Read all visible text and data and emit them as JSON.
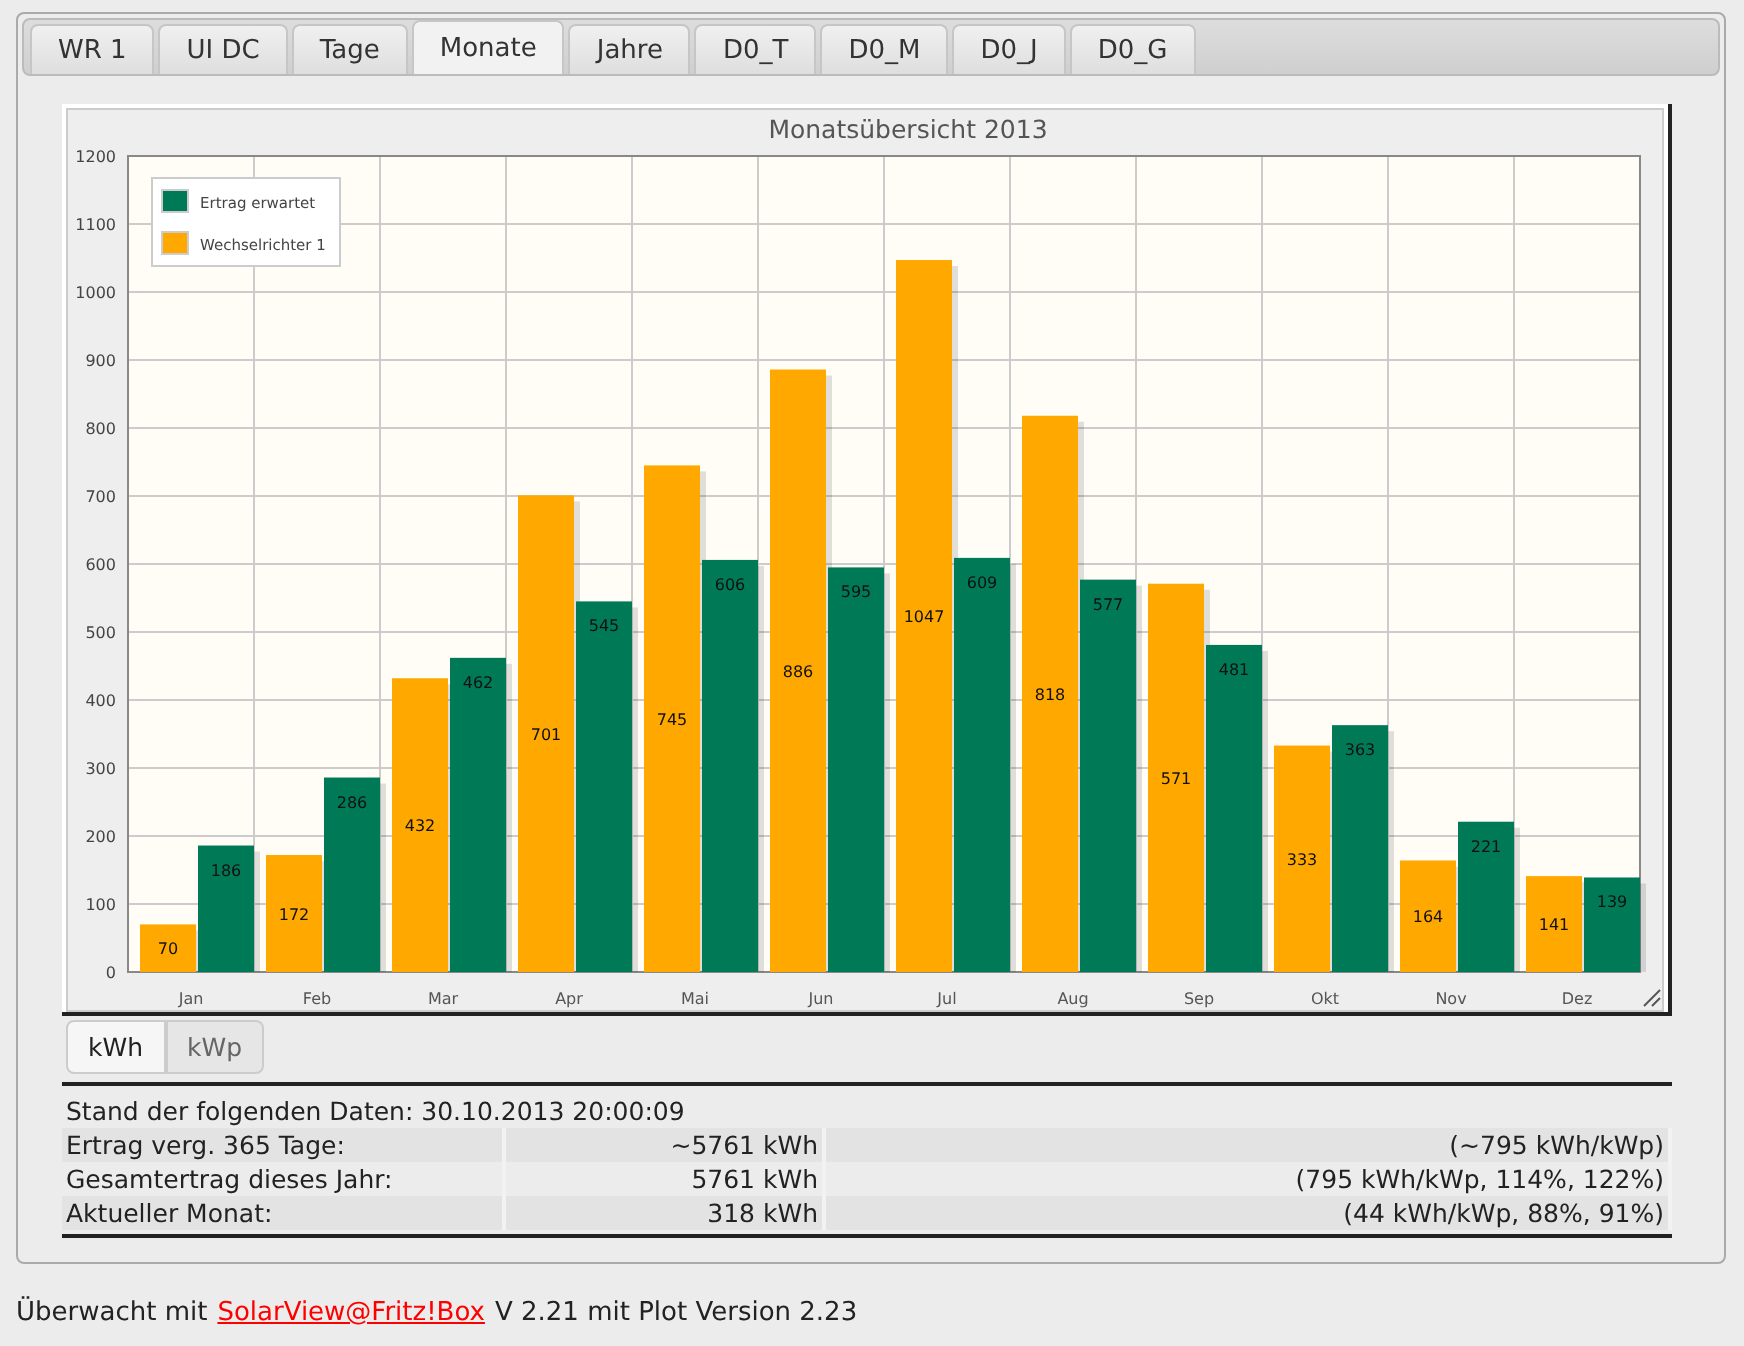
{
  "tabs": [
    {
      "label": "WR 1",
      "selected": false
    },
    {
      "label": "UI DC",
      "selected": false
    },
    {
      "label": "Tage",
      "selected": false
    },
    {
      "label": "Monate",
      "selected": true
    },
    {
      "label": "Jahre",
      "selected": false
    },
    {
      "label": "D0_T",
      "selected": false
    },
    {
      "label": "D0_M",
      "selected": false
    },
    {
      "label": "D0_J",
      "selected": false
    },
    {
      "label": "D0_G",
      "selected": false
    }
  ],
  "chart": {
    "chart_data": {
      "type": "bar",
      "title": "Monatsübersicht 2013",
      "categories": [
        "Jan",
        "Feb",
        "Mar",
        "Apr",
        "Mai",
        "Jun",
        "Jul",
        "Aug",
        "Sep",
        "Okt",
        "Nov",
        "Dez"
      ],
      "series": [
        {
          "name": "Wechselrichter 1",
          "color": "#ffa800",
          "values": [
            70,
            172,
            432,
            701,
            745,
            886,
            1047,
            818,
            571,
            333,
            164,
            141
          ]
        },
        {
          "name": "Ertrag erwartet",
          "color": "#007a56",
          "values": [
            186,
            286,
            462,
            545,
            606,
            595,
            609,
            577,
            481,
            363,
            221,
            139
          ]
        }
      ],
      "ylim": [
        0,
        1200
      ],
      "grid": true,
      "legend": true,
      "yticks": [
        0,
        100,
        200,
        300,
        400,
        500,
        600,
        700,
        800,
        900,
        1000,
        1100,
        1200
      ],
      "data_labels": true
    }
  },
  "unit_buttons": [
    {
      "label": "kWh",
      "selected": true
    },
    {
      "label": "kWp",
      "selected": false
    }
  ],
  "data_stamp": "Stand der folgenden Daten: 30.10.2013 20:00:09",
  "summary_rows": [
    {
      "label": "Ertrag verg. 365 Tage:",
      "value": "~5761 kWh",
      "detail": "(~795 kWh/kWp)"
    },
    {
      "label": "Gesamtertrag dieses Jahr:",
      "value": "5761 kWh",
      "detail": "(795 kWh/kWp, 114%, 122%)"
    },
    {
      "label": "Aktueller Monat:",
      "value": "318 kWh",
      "detail": "(44 kWh/kWp, 88%, 91%)"
    }
  ],
  "footer": {
    "before": "Überwacht mit",
    "link": "SolarView@Fritz!Box",
    "after": "V 2.21 mit Plot Version 2.23"
  }
}
